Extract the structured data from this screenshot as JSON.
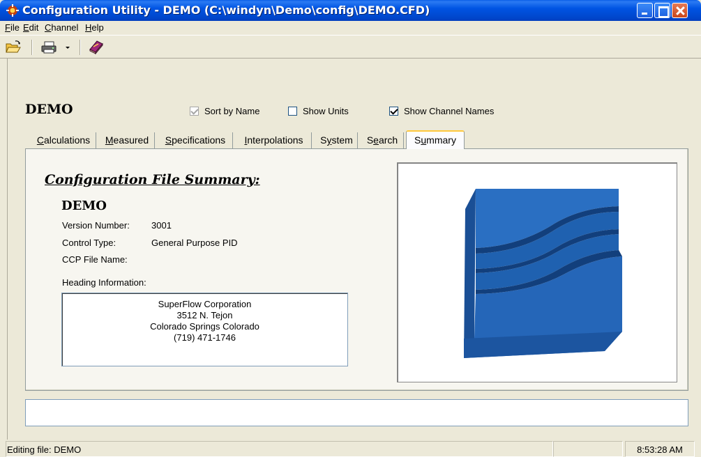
{
  "window": {
    "title": "Configuration Utility - DEMO  (C:\\windyn\\Demo\\config\\DEMO.CFD)"
  },
  "menu": {
    "items": [
      {
        "label": "File",
        "accel": "F",
        "rest": "ile"
      },
      {
        "label": "Edit",
        "accel": "E",
        "rest": "dit"
      },
      {
        "label": "Channel",
        "accel": "C",
        "rest": "hannel"
      },
      {
        "label": "Help",
        "accel": "H",
        "rest": "elp"
      }
    ]
  },
  "toolbar": {
    "icons": [
      "open-folder-icon",
      "print-icon",
      "dropdown-arrow-icon",
      "book-icon"
    ]
  },
  "header": {
    "config_name": "DEMO",
    "sort_by_name": {
      "label": "Sort by Name",
      "checked": true,
      "enabled": false
    },
    "show_units": {
      "label": "Show Units",
      "checked": false,
      "enabled": true
    },
    "show_channel_names": {
      "label": "Show Channel Names",
      "checked": true,
      "enabled": true
    }
  },
  "tabs": [
    {
      "label": "Calculations",
      "accel": "C",
      "rest": "alculations"
    },
    {
      "label": "Measured",
      "accel": "M",
      "rest": "easured"
    },
    {
      "label": "Specifications",
      "accel": "S",
      "rest": "pecifications"
    },
    {
      "label": "Interpolations",
      "accel": "I",
      "rest": "nterpolations"
    },
    {
      "label": "System",
      "pre": "S",
      "accel": "y",
      "rest": "stem"
    },
    {
      "label": "Search",
      "pre": "S",
      "accel": "e",
      "rest": "arch"
    },
    {
      "label": "Summary",
      "pre": "S",
      "accel": "u",
      "rest": "mmary",
      "active": true
    }
  ],
  "summary": {
    "title": "Configuration File Summary:",
    "name": "DEMO",
    "version_label": "Version Number:",
    "version_value": "3001",
    "control_label": "Control Type:",
    "control_value": "General Purpose PID",
    "ccp_label": "CCP File Name:",
    "ccp_value": "",
    "heading_label": "Heading Information:",
    "heading_lines": [
      "SuperFlow Corporation",
      "3512 N. Tejon",
      "Colorado Springs Colorado",
      "(719) 471-1746"
    ]
  },
  "logo": {
    "color": "#1f63b0"
  },
  "status": {
    "message": "Editing file: DEMO",
    "time": "8:53:28 AM"
  }
}
